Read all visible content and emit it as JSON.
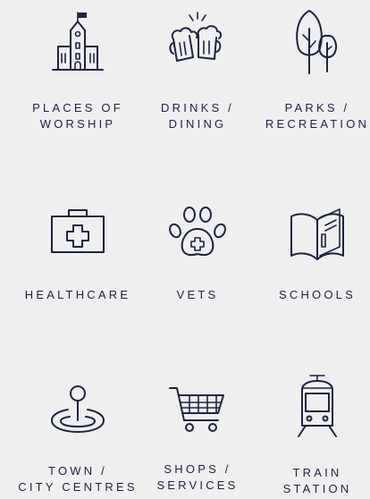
{
  "colors": {
    "background": "#efefef",
    "ink": "#1d2440"
  },
  "categories": [
    {
      "id": "worship",
      "icon": "church-icon",
      "line1": "PLACES OF",
      "line2": "WORSHIP"
    },
    {
      "id": "drinks",
      "icon": "beer-mugs-icon",
      "line1": "DRINKS /",
      "line2": "DINING"
    },
    {
      "id": "parks",
      "icon": "trees-icon",
      "line1": "PARKS /",
      "line2": "RECREATION"
    },
    {
      "id": "healthcare",
      "icon": "first-aid-kit-icon",
      "line1": "HEALTHCARE",
      "line2": ""
    },
    {
      "id": "vets",
      "icon": "paw-print-icon",
      "line1": "VETS",
      "line2": ""
    },
    {
      "id": "schools",
      "icon": "open-book-icon",
      "line1": "SCHOOLS",
      "line2": ""
    },
    {
      "id": "town",
      "icon": "location-pin-icon",
      "line1": "TOWN /",
      "line2": "CITY CENTRES"
    },
    {
      "id": "shops",
      "icon": "shopping-cart-icon",
      "line1": "SHOPS /",
      "line2": "SERVICES"
    },
    {
      "id": "train",
      "icon": "train-icon",
      "line1": "TRAIN",
      "line2": "STATION"
    }
  ]
}
